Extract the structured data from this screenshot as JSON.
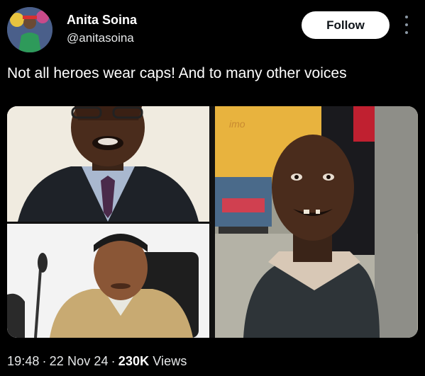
{
  "author": {
    "name": "Anita Soina",
    "handle": "@anitasoina"
  },
  "actions": {
    "follow_label": "Follow"
  },
  "tweet": {
    "text": "Not all heroes wear caps! And to many other voices"
  },
  "media": {
    "tiles": [
      {
        "description": "man in suit and purple tie"
      },
      {
        "description": "man in tan suit at microphone"
      },
      {
        "description": "smiling boy in street beside yellow sign"
      }
    ],
    "sign_text": "imo"
  },
  "meta": {
    "time": "19:48",
    "date": "22 Nov 24",
    "views_count": "230K",
    "views_label": "Views"
  },
  "colors": {
    "background": "#000000",
    "text": "#e7e9ea",
    "follow_bg": "#ffffff"
  }
}
